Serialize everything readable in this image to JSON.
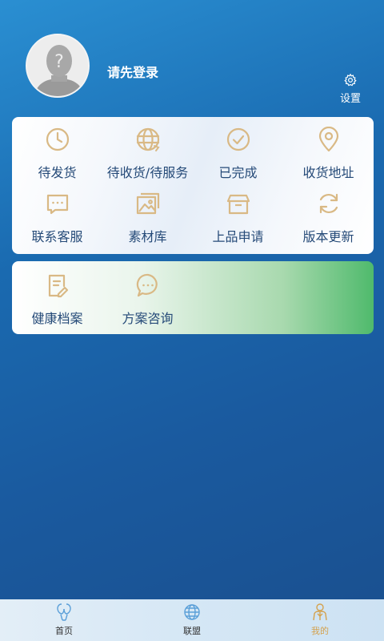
{
  "header": {
    "login_prompt": "请先登录",
    "settings_label": "设置"
  },
  "colors": {
    "icon_gold": "#d9b985",
    "label_blue": "#254a78",
    "active_tab": "#d4a24e"
  },
  "orders_menu": [
    {
      "label": "待发货",
      "icon": "clock-icon"
    },
    {
      "label": "待收货/待服务",
      "icon": "globe-icon"
    },
    {
      "label": "已完成",
      "icon": "check-circle-icon"
    },
    {
      "label": "收货地址",
      "icon": "location-pin-icon"
    },
    {
      "label": "联系客服",
      "icon": "chat-bubble-icon"
    },
    {
      "label": "素材库",
      "icon": "image-gallery-icon"
    },
    {
      "label": "上品申请",
      "icon": "box-icon"
    },
    {
      "label": "版本更新",
      "icon": "refresh-icon"
    }
  ],
  "health_menu": [
    {
      "label": "健康档案",
      "icon": "document-edit-icon"
    },
    {
      "label": "方案咨询",
      "icon": "chat-dots-icon"
    }
  ],
  "tabbar": [
    {
      "label": "首页",
      "icon": "home-balloon-icon",
      "active": false
    },
    {
      "label": "联盟",
      "icon": "globe-network-icon",
      "active": false
    },
    {
      "label": "我的",
      "icon": "person-icon",
      "active": true
    }
  ]
}
